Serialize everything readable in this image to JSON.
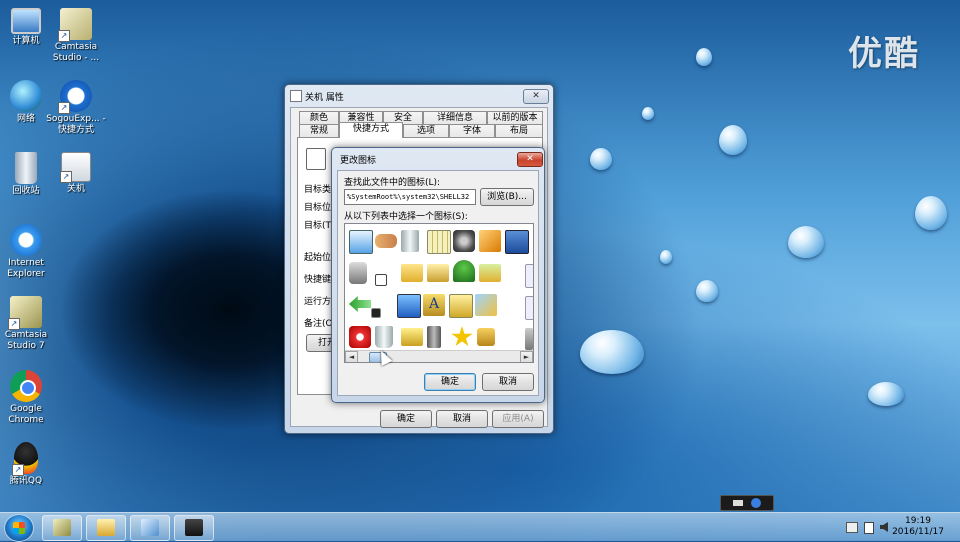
{
  "watermark": "优酷",
  "desktop_icons": [
    {
      "label": "计算机",
      "icon": "computer-icon"
    },
    {
      "label": "Camtasia Studio - ...",
      "icon": "camtasia-shortcut-icon"
    },
    {
      "label": "网络",
      "icon": "network-icon"
    },
    {
      "label": "SogouExp... - 快捷方式",
      "icon": "sogou-explorer-icon"
    },
    {
      "label": "回收站",
      "icon": "recycle-bin-icon"
    },
    {
      "label": "关机",
      "icon": "shutdown-shortcut-icon"
    },
    {
      "label": "Internet Explorer",
      "icon": "ie-icon"
    },
    {
      "label": "Camtasia Studio 7",
      "icon": "camtasia-icon"
    },
    {
      "label": "Google Chrome",
      "icon": "chrome-icon"
    },
    {
      "label": "腾讯QQ",
      "icon": "qq-icon"
    }
  ],
  "properties_dialog": {
    "title": "关机 属性",
    "close": "✕",
    "tabs_row1": [
      "颜色",
      "兼容性",
      "安全",
      "详细信息",
      "以前的版本"
    ],
    "tabs_row2": [
      "常规",
      "快捷方式",
      "选项",
      "字体",
      "布局"
    ],
    "selected_tab": "快捷方式",
    "fields": [
      "目标类型",
      "目标位置",
      "目标(T)",
      "起始位置",
      "快捷键",
      "运行方式",
      "备注(O)"
    ],
    "open_button": "打开",
    "ok": "确定",
    "cancel": "取消",
    "apply": "应用(A)"
  },
  "change_icon_dialog": {
    "title": "更改图标",
    "close": "✕",
    "find_label": "查找此文件中的图标(L):",
    "path_value": "%SystemRoot%\\system32\\SHELL32",
    "browse": "浏览(B)...",
    "list_label": "从以下列表中选择一个图标(S):",
    "icons": [
      "monitor-icon",
      "handshake-icon",
      "recycle-bin-full-icon",
      "window-grid-icon",
      "disk-drive-icon",
      "key-icon",
      "computer-window-icon",
      "monitor-icon",
      "speaker-icon",
      "shortcut-arrow-icon",
      "folder-key-icon",
      "folder-check-icon",
      "tree-icon",
      "folder-arrow-icon",
      "window-icon",
      "blank-icon",
      "green-arrow-icon",
      "box-icon",
      "display-icon",
      "font-icon",
      "folder-monitor-icon",
      "pictures-icon",
      "window-icon",
      "blank-icon",
      "power-icon",
      "recycle-bin-icon",
      "folder-users-icon",
      "server-icon",
      "star-icon",
      "padlock-icon",
      "mixer-icon",
      "blank-icon"
    ],
    "scroll_left": "◄",
    "scroll_right": "►",
    "ok": "确定",
    "cancel": "取消"
  },
  "taskbar": {
    "apps": [
      "camtasia-app-icon",
      "explorer-folder-icon",
      "camtasia-recorder-icon",
      "video-camera-icon"
    ],
    "time": "19:19",
    "date": "2016/11/17"
  },
  "colors": {
    "accent": "#1b78c8",
    "close_red": "#c7432b"
  }
}
